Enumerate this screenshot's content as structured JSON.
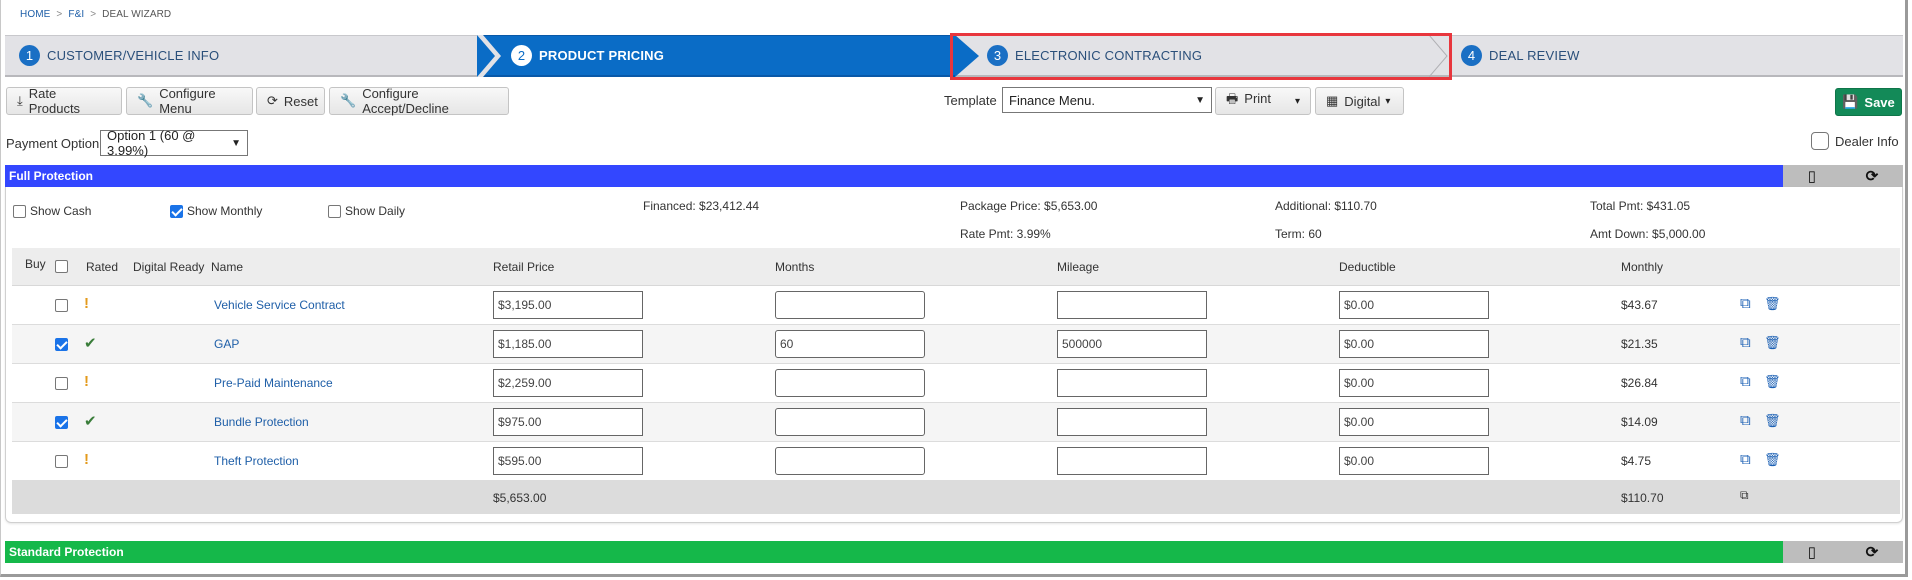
{
  "breadcrumb": [
    {
      "label": "HOME"
    },
    {
      "label": "F&I"
    },
    {
      "label": "DEAL WIZARD"
    }
  ],
  "breadcrumb_separator": ">",
  "wizard": {
    "steps": [
      {
        "number": "1",
        "label": "CUSTOMER/VEHICLE INFO",
        "state": "default"
      },
      {
        "number": "2",
        "label": "PRODUCT PRICING",
        "state": "active"
      },
      {
        "number": "3",
        "label": "ELECTRONIC CONTRACTING",
        "state": "highlighted"
      },
      {
        "number": "4",
        "label": "DEAL REVIEW",
        "state": "default"
      }
    ]
  },
  "toolbar": {
    "rate_products": "Rate Products",
    "configure_menu": "Configure Menu",
    "reset": "Reset",
    "configure_accept_decline": "Configure Accept/Decline",
    "template_label": "Template",
    "template_value": "Finance Menu.",
    "print": "Print",
    "digital": "Digital",
    "save": "Save"
  },
  "payment_option": {
    "label": "Payment Option",
    "value": "Option 1 (60 @ 3.99%)"
  },
  "dealer_info": {
    "label": "Dealer Info",
    "checked": false
  },
  "colors": {
    "full_protection": "#3347ff",
    "standard_protection": "#15b84a",
    "active_step": "#0a6cc6",
    "save": "#138a58",
    "highlight": "#e8363d"
  },
  "full_protection": {
    "title": "Full Protection",
    "options": {
      "show_cash": {
        "label": "Show Cash",
        "checked": false
      },
      "show_monthly": {
        "label": "Show Monthly",
        "checked": true
      },
      "show_daily": {
        "label": "Show Daily",
        "checked": false
      }
    },
    "summary": {
      "financed": "Financed: $23,412.44",
      "package_price": "Package Price: $5,653.00",
      "rate_pmt": "Rate Pmt: 3.99%",
      "additional": "Additional: $110.70",
      "term": "Term: 60",
      "total_pmt": "Total Pmt: $431.05",
      "amt_down": "Amt Down: $5,000.00"
    },
    "columns": {
      "buy": "Buy",
      "rated": "Rated",
      "digital_ready": "Digital Ready",
      "name": "Name",
      "retail_price": "Retail Price",
      "months": "Months",
      "mileage": "Mileage",
      "deductible": "Deductible",
      "monthly": "Monthly"
    },
    "rows": [
      {
        "buy": false,
        "rated": "warning",
        "name": "Vehicle Service Contract",
        "retail_price": "$3,195.00",
        "months": "",
        "mileage": "",
        "deductible": "$0.00",
        "monthly": "$43.67"
      },
      {
        "buy": true,
        "rated": "ok",
        "name": "GAP",
        "retail_price": "$1,185.00",
        "months": "60",
        "mileage": "500000",
        "deductible": "$0.00",
        "monthly": "$21.35"
      },
      {
        "buy": false,
        "rated": "warning",
        "name": "Pre-Paid Maintenance",
        "retail_price": "$2,259.00",
        "months": "",
        "mileage": "",
        "deductible": "$0.00",
        "monthly": "$26.84"
      },
      {
        "buy": true,
        "rated": "ok",
        "name": "Bundle Protection",
        "retail_price": "$975.00",
        "months": "",
        "mileage": "",
        "deductible": "$0.00",
        "monthly": "$14.09"
      },
      {
        "buy": false,
        "rated": "warning",
        "name": "Theft Protection",
        "retail_price": "$595.00",
        "months": "",
        "mileage": "",
        "deductible": "$0.00",
        "monthly": "$4.75"
      }
    ],
    "totals": {
      "retail_price": "$5,653.00",
      "monthly": "$110.70"
    }
  },
  "standard_protection": {
    "title": "Standard Protection"
  },
  "icons": {
    "rated_warning": "!",
    "rated_ok": "✔",
    "copy": "⧉",
    "delete": "🗑",
    "mobile": "▯",
    "refresh": "⟳"
  }
}
